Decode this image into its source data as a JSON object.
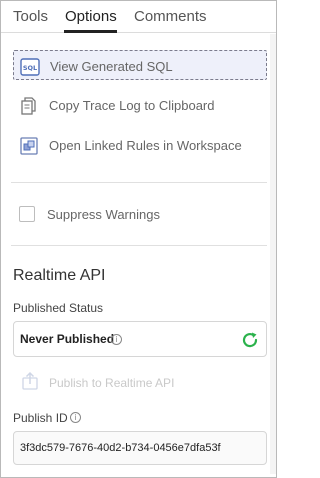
{
  "tabs": [
    {
      "label": "Tools"
    },
    {
      "label": "Options"
    },
    {
      "label": "Comments"
    }
  ],
  "actions": {
    "view_sql": {
      "label": "View Generated SQL",
      "icon": "sql-icon"
    },
    "copy_trace": {
      "label": "Copy Trace Log to Clipboard",
      "icon": "copy-document-icon"
    },
    "open_rules": {
      "label": "Open Linked Rules in Workspace",
      "icon": "linked-rules-icon"
    }
  },
  "suppress_warnings": {
    "label": "Suppress Warnings",
    "checked": false
  },
  "realtime": {
    "title": "Realtime API",
    "published_status_label": "Published Status",
    "status_value": "Never Published",
    "publish_button_label": "Publish to Realtime API",
    "publish_id_label": "Publish ID",
    "publish_id_value": "3f3dc579-7676-40d2-b734-0456e7dfa53f"
  },
  "colors": {
    "refresh_green": "#2bb24c",
    "highlight_bg": "#eef0fa",
    "sql_icon_blue": "#4f6fb8"
  }
}
